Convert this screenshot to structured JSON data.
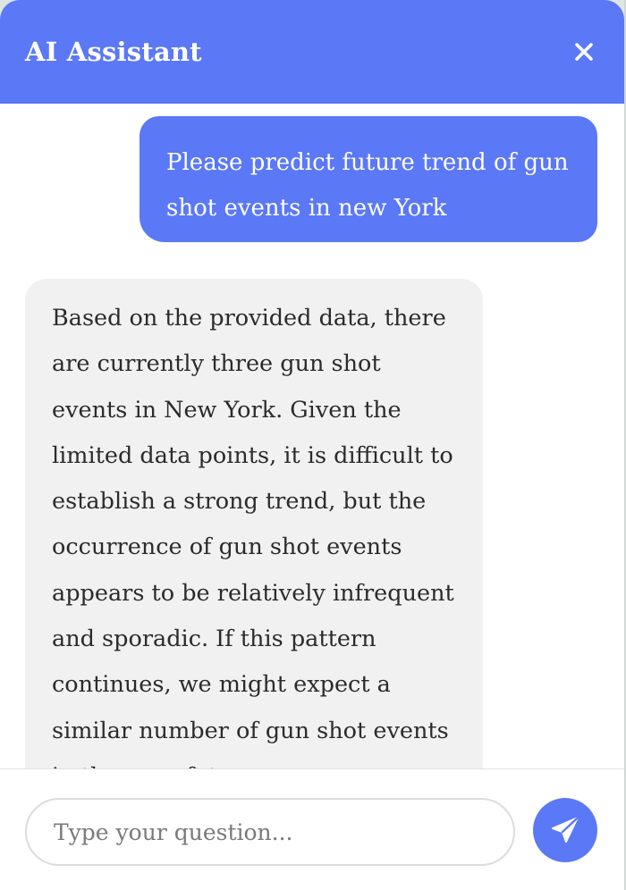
{
  "header": {
    "title": "AI Assistant",
    "close_icon": "close-icon"
  },
  "messages": [
    {
      "role": "user",
      "text": "Please predict future trend of gun shot events in new York"
    },
    {
      "role": "assistant",
      "text": "Based on the provided data, there are currently three gun shot events in New York. Given the limited data points, it is difficult to establish a strong trend, but the occurrence of gun shot events appears to be relatively infrequent and sporadic. If this pattern continues, we might expect a similar number of gun shot events in the near future."
    }
  ],
  "composer": {
    "placeholder": "Type your question...",
    "value": "",
    "send_icon": "paper-plane-icon"
  },
  "colors": {
    "accent": "#5b78f6",
    "bot_bubble": "#f1f1f1",
    "header_text": "#ffffff"
  }
}
